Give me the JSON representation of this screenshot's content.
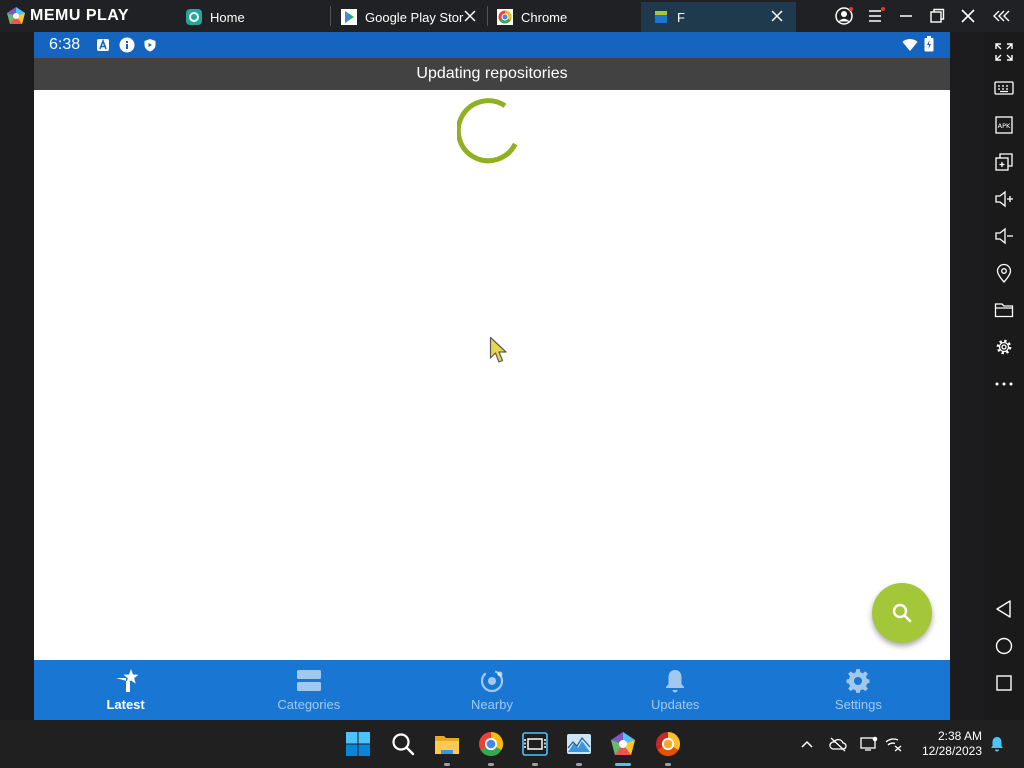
{
  "emulator": {
    "brand": "MEMU PLAY",
    "tabs": [
      {
        "label": "Home",
        "icon": "home-icon"
      },
      {
        "label": "Google Play Stor",
        "icon": "play-store-icon"
      },
      {
        "label": "Chrome",
        "icon": "chrome-icon"
      },
      {
        "label": "F",
        "icon": "fdroid-icon"
      }
    ],
    "active_tab": 3
  },
  "android": {
    "status_bar": {
      "time": "6:38",
      "icons": [
        "a-icon",
        "info-icon",
        "shield-icon",
        "wifi-icon",
        "battery-icon"
      ]
    },
    "app_bar_title": "Updating repositories",
    "fab_icon": "search-icon",
    "bottom_nav": [
      {
        "label": "Latest",
        "icon": "star-tag-icon",
        "active": true
      },
      {
        "label": "Categories",
        "icon": "categories-icon",
        "active": false
      },
      {
        "label": "Nearby",
        "icon": "nearby-icon",
        "active": false
      },
      {
        "label": "Updates",
        "icon": "bell-icon",
        "active": false
      },
      {
        "label": "Settings",
        "icon": "gear-icon",
        "active": false
      }
    ]
  },
  "colors": {
    "status_bar": "#1565c0",
    "app_bar": "#424242",
    "bottom_nav": "#1976d2",
    "accent": "#a4c639",
    "spinner": "#8fb021"
  },
  "sidebar_tools": [
    "fullscreen-icon",
    "keyboard-icon",
    "apk-icon",
    "multi-window-icon",
    "volume-up-icon",
    "volume-down-icon",
    "location-icon",
    "folder-icon",
    "settings-icon",
    "more-icon",
    "back-icon",
    "home-circle-icon",
    "recents-icon"
  ],
  "taskbar": {
    "apps": [
      "windows-start-icon",
      "search-icon",
      "file-explorer-icon",
      "chrome-icon",
      "video-editor-icon",
      "photos-icon",
      "memu-icon",
      "chrome-canary-icon"
    ],
    "time": "2:38 AM",
    "date": "12/28/2023"
  }
}
